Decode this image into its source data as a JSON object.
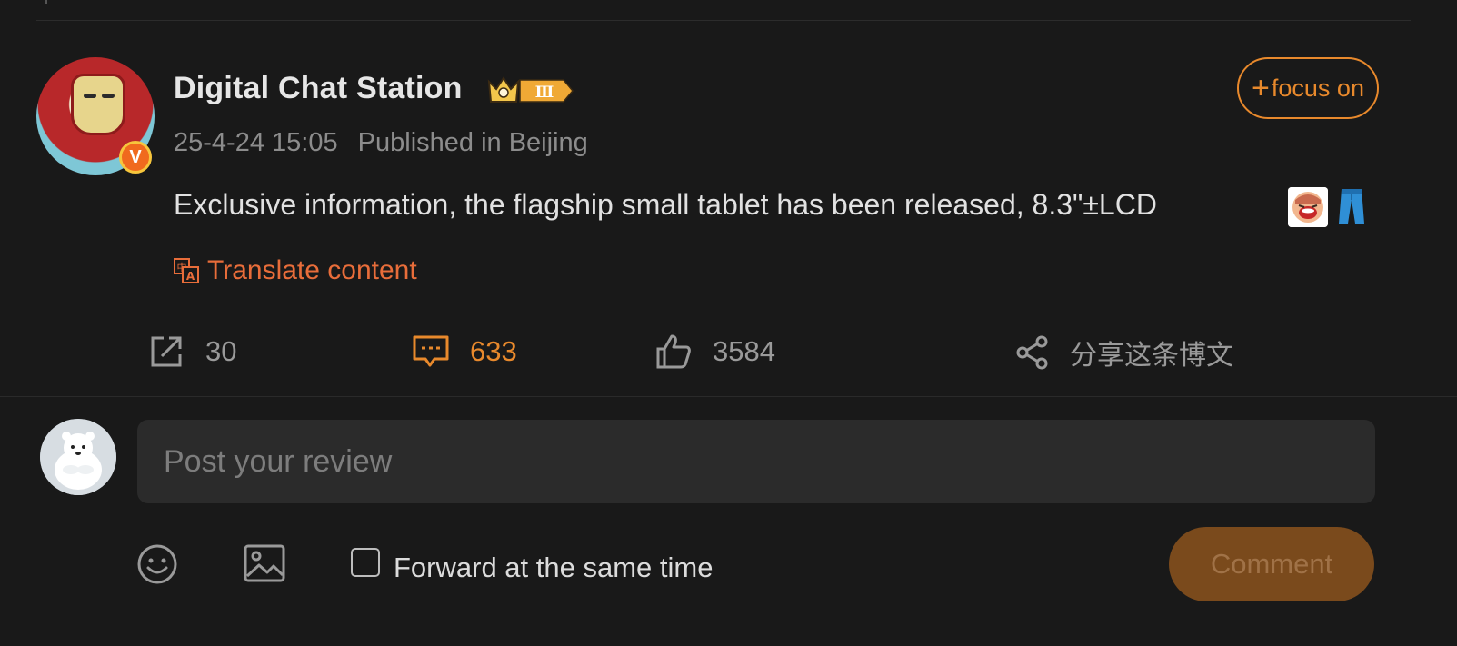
{
  "post": {
    "username": "Digital Chat Station",
    "verified_badge": "V",
    "level_badge": "Ⅲ",
    "timestamp": "25-4-24 15:05",
    "location": "Published in Beijing",
    "follow_label": "focus on",
    "follow_plus": "+",
    "text": "Exclusive information, the flagship small tablet has been released, 8.3\"±LCD",
    "emojis": [
      "laughing-crying-emoji",
      "jeans-emoji"
    ],
    "translate_label": "Translate content"
  },
  "actions": {
    "repost_count": "30",
    "comment_count": "633",
    "like_count": "3584",
    "share_label": "分享这条博文"
  },
  "composer": {
    "placeholder": "Post your review",
    "forward_label": "Forward at the same time",
    "forward_checked": false,
    "comment_button": "Comment"
  },
  "colors": {
    "background": "#191919",
    "accent": "#e8892c",
    "translate": "#e86d3a",
    "muted": "#8c8c8c",
    "comment_button_bg": "#7a4a1c"
  },
  "icons": [
    "repost-icon",
    "comment-icon",
    "like-icon",
    "share-icon",
    "translate-icon",
    "emoji-icon",
    "image-icon"
  ]
}
